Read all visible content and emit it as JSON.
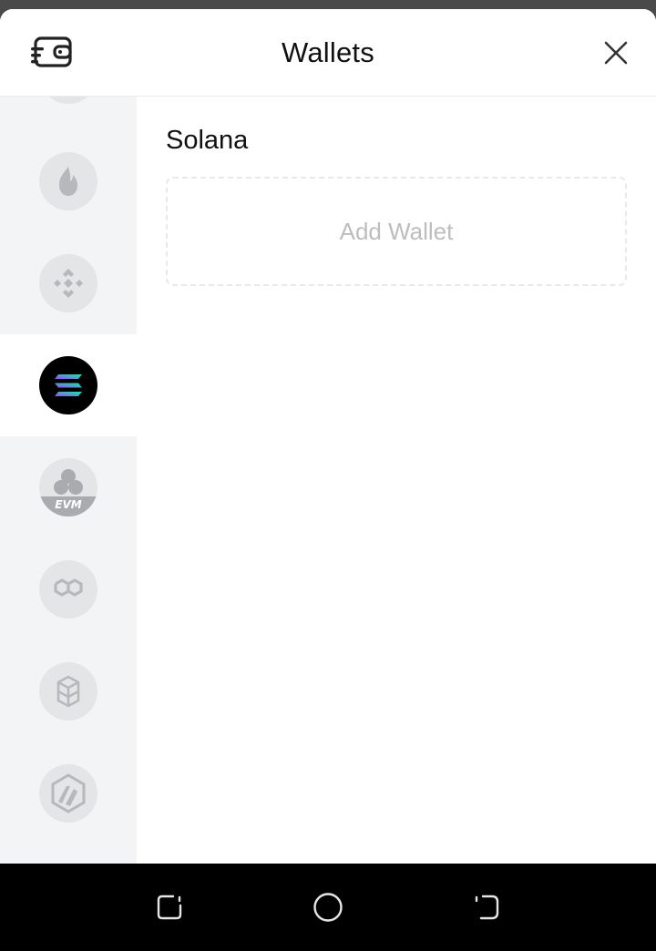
{
  "header": {
    "title": "Wallets",
    "left_icon": "wallet-icon",
    "close_icon": "close-icon"
  },
  "sidebar": {
    "items": [
      {
        "id": "fire-chain",
        "icon": "flame-icon",
        "active": false
      },
      {
        "id": "bnb-chain",
        "icon": "bnb-icon",
        "active": false
      },
      {
        "id": "solana",
        "icon": "solana-icon",
        "active": true
      },
      {
        "id": "evm",
        "icon": "evm-icon",
        "label": "EVM",
        "active": false
      },
      {
        "id": "polygon",
        "icon": "polygon-icon",
        "active": false
      },
      {
        "id": "fantom",
        "icon": "fantom-icon",
        "active": false
      },
      {
        "id": "arbitrum",
        "icon": "arbitrum-icon",
        "active": false
      }
    ]
  },
  "main": {
    "chain_name": "Solana",
    "add_wallet_label": "Add Wallet"
  },
  "colors": {
    "sidebar_bg": "#f3f4f6",
    "inactive_icon_bg": "#e4e5e7",
    "inactive_icon_fg": "#b7b8bb",
    "placeholder_text": "#bdbdbd",
    "solana_gradient_start": "#9945ff",
    "solana_gradient_end": "#14f195"
  },
  "system_nav": {
    "buttons": [
      "recent-apps-icon",
      "home-icon",
      "back-icon"
    ]
  }
}
